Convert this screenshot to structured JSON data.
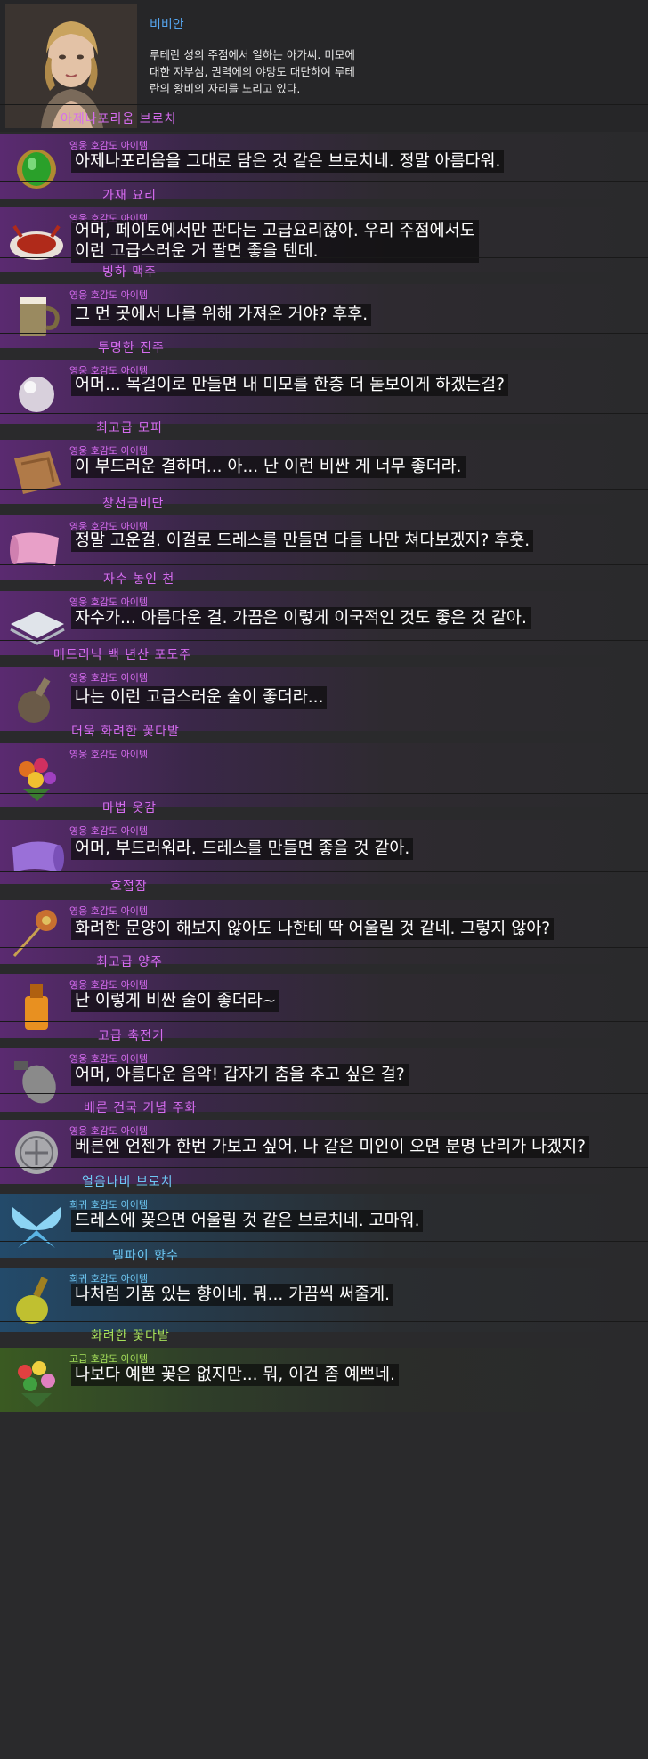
{
  "character": {
    "name": "비비안",
    "description": "루테란 성의 주점에서 일하는 아가씨. 미모에\n대한 자부심, 권력에의 야망도 대단하여 루테\n란의 왕비의 자리를 노리고 있다."
  },
  "colors": {
    "epic": "#d66cf0",
    "rare": "#6ec8f4",
    "uncommon": "#a6e05a",
    "name": "#56a6f0"
  },
  "items": [
    {
      "name": "아제나포리움 브로치",
      "grade": "영웅 호감도 아이템",
      "rarity": "epic",
      "icon": "green-gem-brooch-icon",
      "quote": "아제나포리움을 그대로 담은 것 같은 브로치네. 정말 아름다워."
    },
    {
      "name": "가재 요리",
      "grade": "영웅 호감도 아이템",
      "rarity": "epic",
      "icon": "crayfish-dish-icon",
      "quote": "어머, 페이토에서만 판다는 고급요리잖아. 우리 주점에서도\n이런 고급스러운 거 팔면 좋을 텐데."
    },
    {
      "name": "빙하 맥주",
      "grade": "영웅 호감도 아이템",
      "rarity": "epic",
      "icon": "beer-mug-icon",
      "quote": "그 먼 곳에서 나를 위해 가져온 거야? 후후."
    },
    {
      "name": "투명한 진주",
      "grade": "영웅 호감도 아이템",
      "rarity": "epic",
      "icon": "pearl-icon",
      "quote": "어머... 목걸이로 만들면 내 미모를 한층 더 돋보이게 하겠는걸?"
    },
    {
      "name": "최고급 모피",
      "grade": "영웅 호감도 아이템",
      "rarity": "epic",
      "icon": "fur-pelt-icon",
      "quote": "이 부드러운 결하며... 아... 난 이런 비싼 게 너무 좋더라."
    },
    {
      "name": "창천금비단",
      "grade": "영웅 호감도 아이템",
      "rarity": "epic",
      "icon": "silk-roll-icon",
      "quote": "정말 고운걸. 이걸로 드레스를 만들면 다들 나만 쳐다보겠지? 후훗."
    },
    {
      "name": "자수 놓인 천",
      "grade": "영웅 호감도 아이템",
      "rarity": "epic",
      "icon": "folded-cloth-icon",
      "quote": "자수가... 아름다운 걸. 가끔은 이렇게 이국적인 것도 좋은 것 같아."
    },
    {
      "name": "메드리닉 백 년산 포도주",
      "grade": "영웅 호감도 아이템",
      "rarity": "epic",
      "icon": "wine-flask-icon",
      "quote": "나는 이런 고급스러운 술이 좋더라..."
    },
    {
      "name": "더욱 화려한 꽃다발",
      "grade": "영웅 호감도 아이템",
      "rarity": "epic",
      "icon": "bouquet-icon",
      "quote": ""
    },
    {
      "name": "마법 옷감",
      "grade": "영웅 호감도 아이템",
      "rarity": "epic",
      "icon": "fabric-bolt-icon",
      "quote": "어머, 부드러워라. 드레스를 만들면 좋을 것 같아."
    },
    {
      "name": "호접잠",
      "grade": "영웅 호감도 아이템",
      "rarity": "epic",
      "icon": "hairpin-icon",
      "quote": "화려한 문양이 해보지 않아도 나한테 딱 어울릴 것 같네. 그렇지 않아?"
    },
    {
      "name": "최고급 양주",
      "grade": "영웅 호감도 아이템",
      "rarity": "epic",
      "icon": "liquor-bottle-icon",
      "quote": "난 이렇게 비싼 술이 좋더라~"
    },
    {
      "name": "고급 축전기",
      "grade": "영웅 호감도 아이템",
      "rarity": "epic",
      "icon": "phonograph-icon",
      "quote": "어머, 아름다운 음악! 갑자기 춤을 추고 싶은 걸?"
    },
    {
      "name": "베른 건국 기념 주화",
      "grade": "영웅 호감도 아이템",
      "rarity": "epic",
      "icon": "coin-icon",
      "quote": "베른엔 언젠가 한번 가보고 싶어. 나 같은 미인이 오면 분명 난리가 나겠지?"
    },
    {
      "name": "얼음나비 브로치",
      "grade": "희귀 호감도 아이템",
      "rarity": "rare",
      "icon": "butterfly-brooch-icon",
      "quote": "드레스에 꽂으면 어울릴 것 같은 브로치네. 고마워."
    },
    {
      "name": "델파이 향수",
      "grade": "희귀 호감도 아이템",
      "rarity": "rare",
      "icon": "perfume-icon",
      "quote": "나처럼 기품 있는 향이네. 뭐... 가끔씩 써줄게."
    },
    {
      "name": "화려한 꽃다발",
      "grade": "고급 호감도 아이템",
      "rarity": "uncommon",
      "icon": "flower-bouquet-icon",
      "quote": "나보다 예쁜 꽃은 없지만... 뭐, 이건 좀 예쁘네."
    }
  ]
}
